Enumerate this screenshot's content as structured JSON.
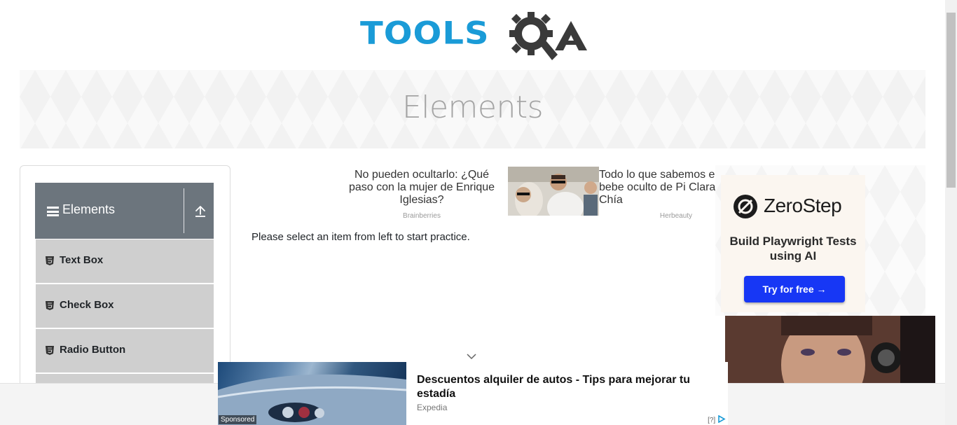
{
  "brand": {
    "logo_text": "TOOLS",
    "logo_suffix": "QA"
  },
  "banner": {
    "title": "Elements"
  },
  "sidebar": {
    "group_title": "Elements",
    "items": [
      {
        "label": "Text Box"
      },
      {
        "label": "Check Box"
      },
      {
        "label": "Radio Button"
      }
    ]
  },
  "main": {
    "instruction": "Please select an item from left to start practice."
  },
  "ads": {
    "inline_1": {
      "text": "No pueden ocultarlo: ¿Qué paso con la mujer de Enrique Iglesias?",
      "source": "Brainberries"
    },
    "inline_2": {
      "text": "Todo lo que sabemos el bebe oculto de Pi Clara Chía",
      "source": "Herbeauty"
    },
    "right": {
      "brand": "ZeroStep",
      "tagline": "Build Playwright Tests using AI",
      "cta": "Try for free →"
    },
    "bottom": {
      "title": "Descuentos alquiler de autos - Tips para mejorar tu estadía",
      "source": "Expedia",
      "sponsored": "Sponsored",
      "choice": "[?]"
    }
  },
  "colors": {
    "brand_blue": "#1a9bd7",
    "brand_dark": "#3a3a3a",
    "group_header": "#6c757d",
    "cta_blue": "#1737f5"
  }
}
